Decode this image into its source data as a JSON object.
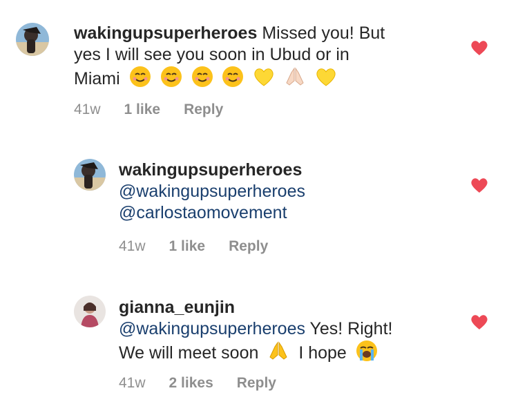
{
  "comments": [
    {
      "username": "wakingupsuperheroes",
      "text_line1": "Missed you! But",
      "text_line2": "yes I will see you soon in Ubud or in",
      "text_line3": "Miami",
      "age": "41w",
      "likes": "1 like",
      "reply": "Reply",
      "avatar": "beach-avatar",
      "liked": true
    },
    {
      "username": "wakingupsuperheroes",
      "mention1": "@wakingupsuperheroes",
      "mention2": "@carlostaomovement",
      "age": "41w",
      "likes": "1 like",
      "reply": "Reply",
      "avatar": "beach-avatar",
      "liked": true
    },
    {
      "username": "gianna_eunjin",
      "mention1": "@wakingupsuperheroes",
      "text_after_mention": "Yes! Right!",
      "text_line2a": "We will meet soon",
      "text_line2b": "I hope",
      "age": "41w",
      "likes": "2 likes",
      "reply": "Reply",
      "avatar": "person-avatar",
      "liked": true
    }
  ],
  "colors": {
    "heart": "#ed4956",
    "mention": "#1a3f6e",
    "meta": "#8e8e8e",
    "text": "#262626"
  }
}
